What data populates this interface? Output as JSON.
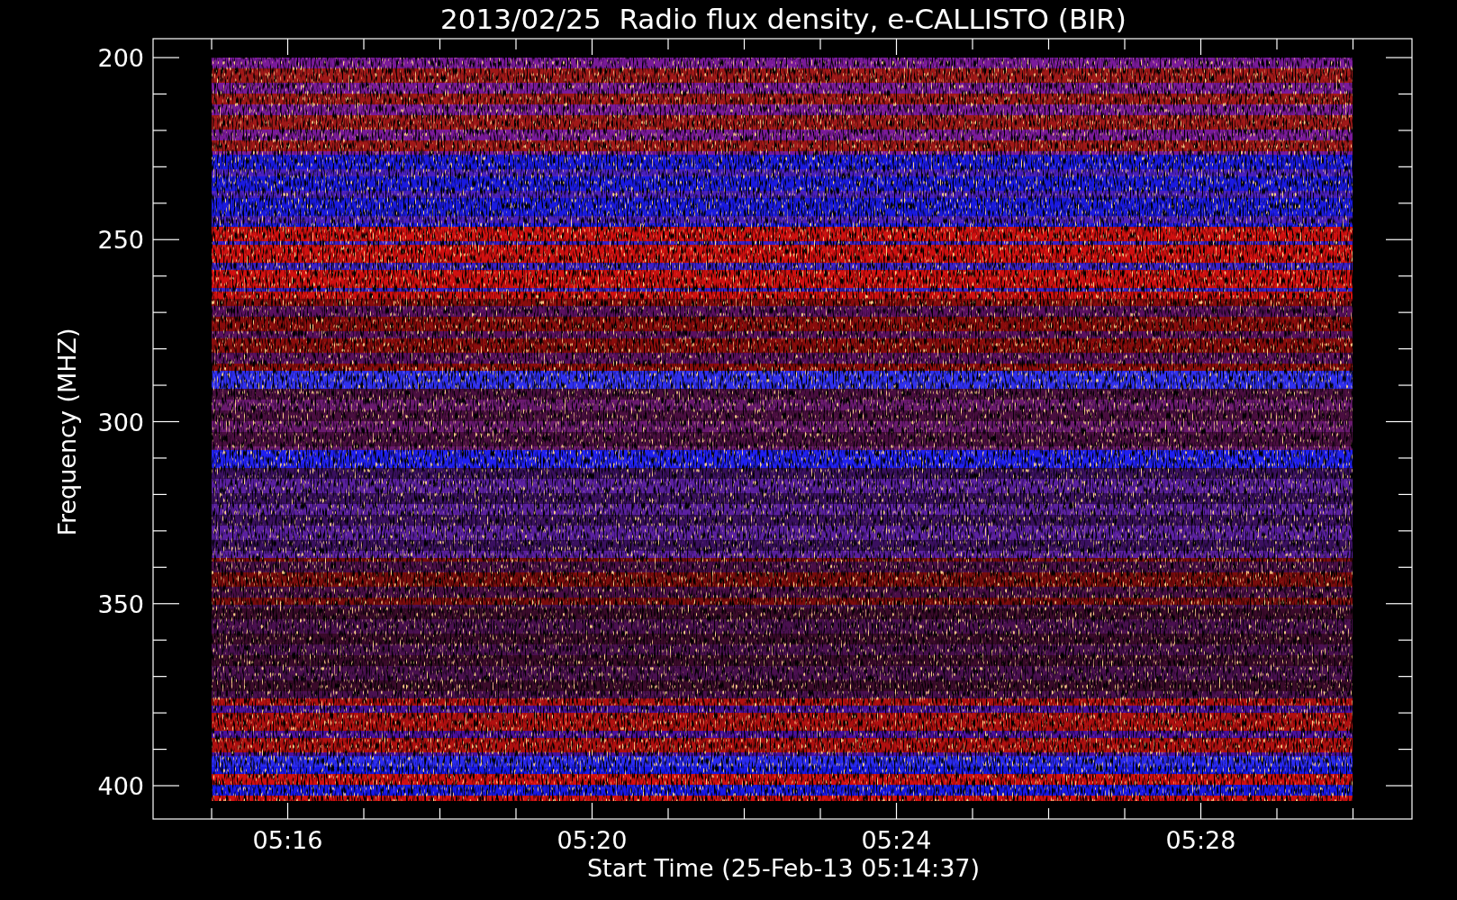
{
  "title": "2013/02/25  Radio flux density, e-CALLISTO (BIR)",
  "y_axis": {
    "label": "Frequency (MHZ)",
    "ticks": [
      "200",
      "250",
      "300",
      "350",
      "400"
    ]
  },
  "x_axis": {
    "label": "Start Time (25-Feb-13 05:14:37)",
    "ticks": [
      "05:16",
      "05:20",
      "05:24",
      "05:28"
    ]
  }
}
